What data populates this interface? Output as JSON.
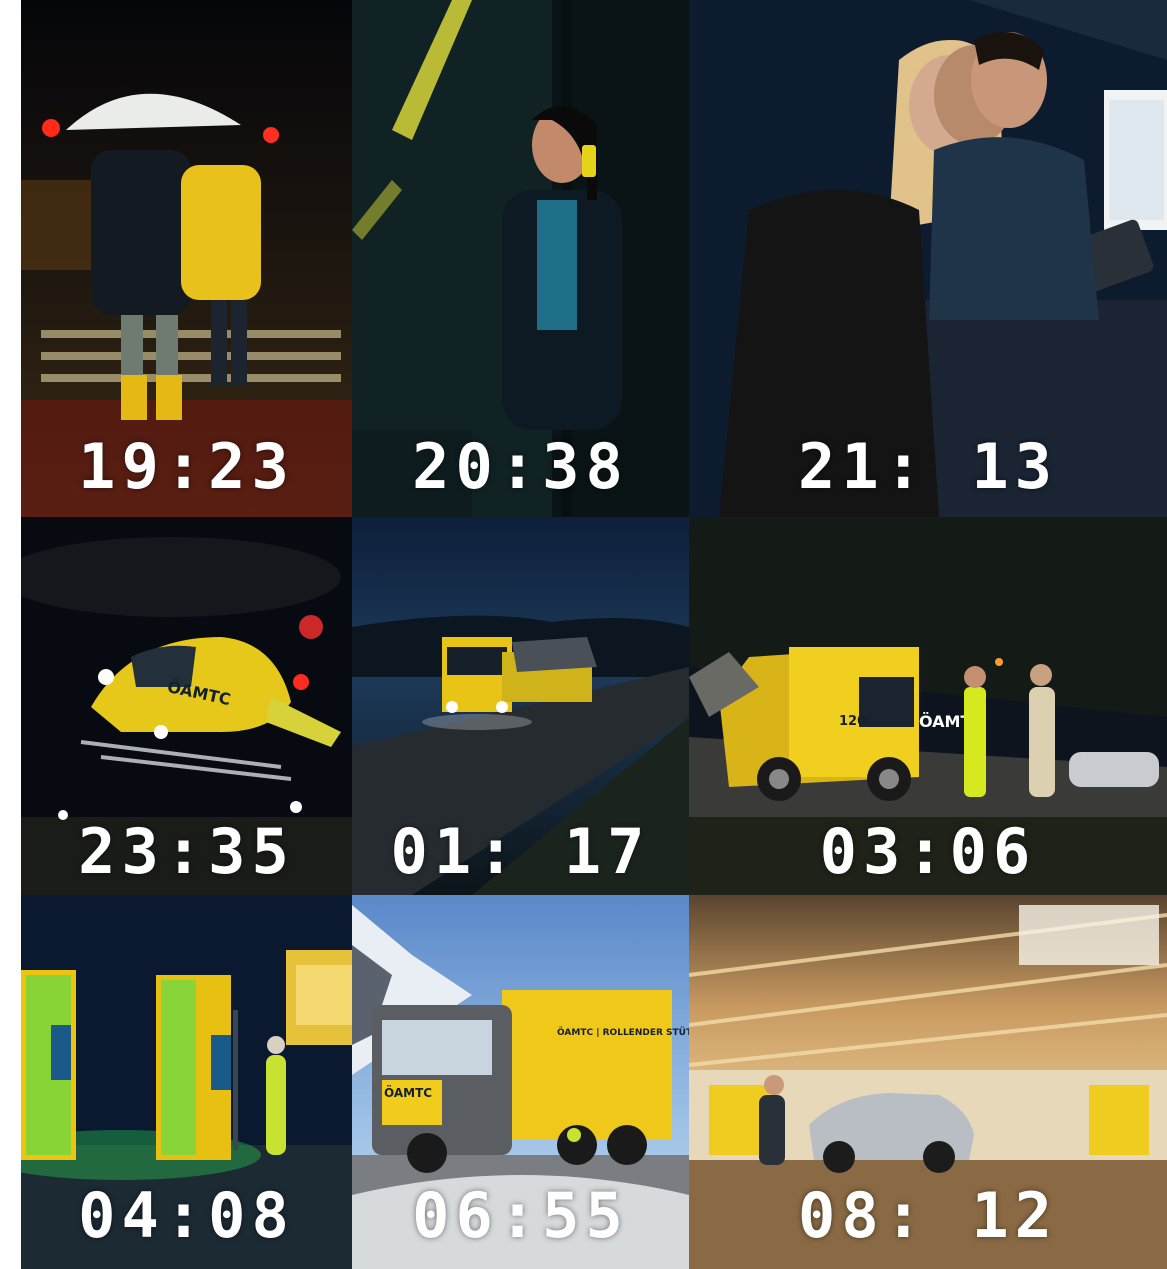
{
  "tiles": [
    {
      "time": "19:23",
      "scene": "umbrella-street"
    },
    {
      "time": "20:38",
      "scene": "woman-phone"
    },
    {
      "time": "21: 13",
      "scene": "call-center"
    },
    {
      "time": "23:35",
      "scene": "helicopter"
    },
    {
      "time": "01: 17",
      "scene": "tow-truck-road"
    },
    {
      "time": "03:06",
      "scene": "roadside-help"
    },
    {
      "time": "04:08",
      "scene": "charging-station"
    },
    {
      "time": "06:55",
      "scene": "truck-snow"
    },
    {
      "time": "08: 12",
      "scene": "workshop"
    }
  ],
  "vehicle_text": {
    "helicopter_logo": "ÖAMTC",
    "van_logo": "ÖAMTC",
    "van_number": "120",
    "truck_logo": "ÖAMTC",
    "truck_side": "ÖAMTC | ROLLENDER STÜTZPUNKT"
  },
  "colors": {
    "brand_yellow": "#f2d21b",
    "night": "#0b1220"
  }
}
